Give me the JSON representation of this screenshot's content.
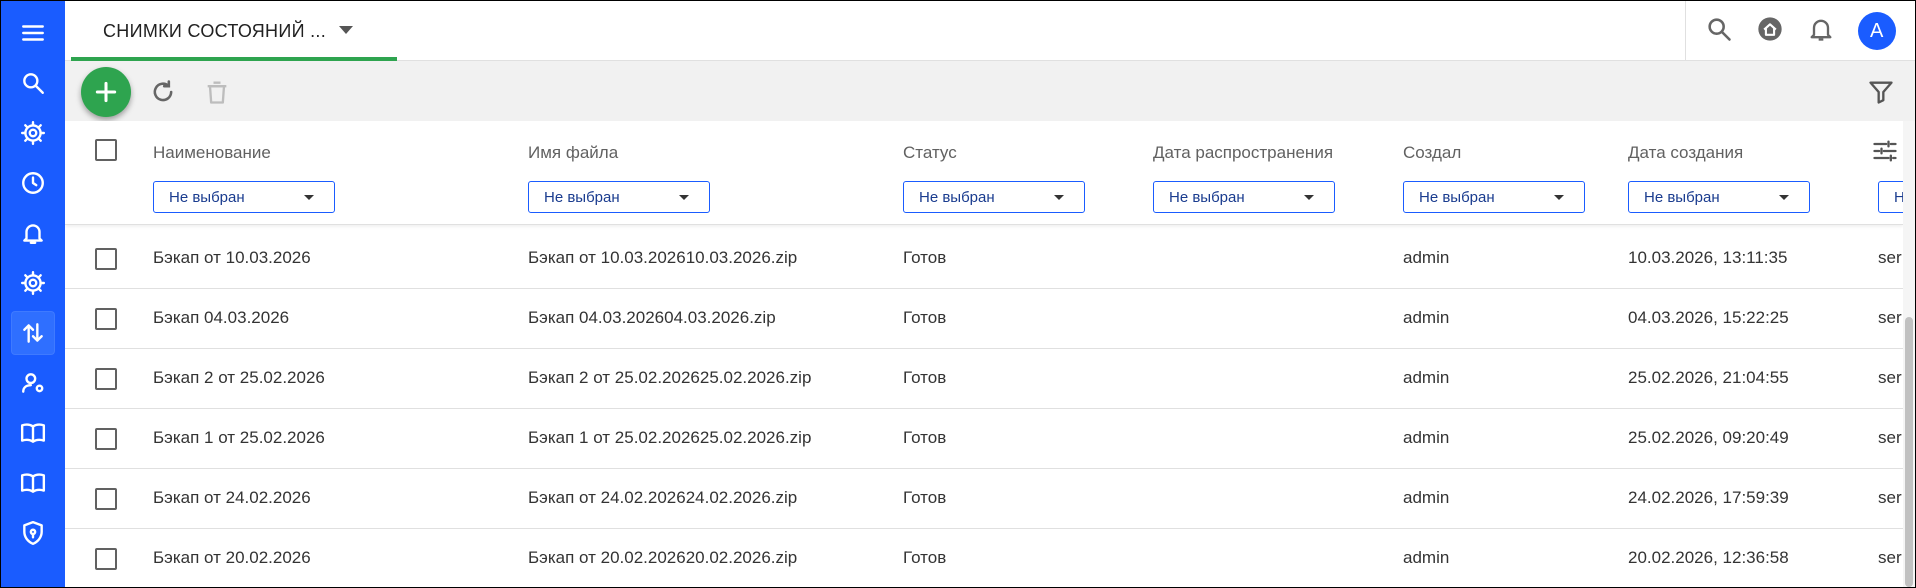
{
  "header": {
    "tab_label": "СНИМКИ СОСТОЯНИЙ ...",
    "avatar_letter": "A"
  },
  "sidebar": {
    "items": [
      {
        "icon": "menu-icon",
        "active": false
      },
      {
        "icon": "search-icon",
        "active": false
      },
      {
        "icon": "gear-icon",
        "active": false
      },
      {
        "icon": "clock-icon",
        "active": false
      },
      {
        "icon": "bell-icon",
        "active": false
      },
      {
        "icon": "gear-icon",
        "active": false
      },
      {
        "icon": "import-export-icon",
        "active": true
      },
      {
        "icon": "user-settings-icon",
        "active": false
      },
      {
        "icon": "book-icon",
        "active": false
      },
      {
        "icon": "book-icon",
        "active": false
      },
      {
        "icon": "shield-icon",
        "active": false
      }
    ]
  },
  "table": {
    "columns": [
      {
        "label": "Наименование",
        "filter": "Не выбран"
      },
      {
        "label": "Имя файла",
        "filter": "Не выбран"
      },
      {
        "label": "Статус",
        "filter": "Не выбран"
      },
      {
        "label": "Дата распространения",
        "filter": "Не выбран"
      },
      {
        "label": "Создал",
        "filter": "Не выбран"
      },
      {
        "label": "Дата создания",
        "filter": "Не выбран"
      },
      {
        "label": "",
        "filter": "Не выбран"
      }
    ],
    "rows": [
      {
        "name": "Бэкап от 10.03.2026",
        "file": "Бэкап от 10.03.202610.03.2026.zip",
        "status": "Готов",
        "dist_date": "",
        "author": "admin",
        "created": "10.03.2026, 13:11:35",
        "extra": "ser"
      },
      {
        "name": "Бэкап 04.03.2026",
        "file": "Бэкап 04.03.202604.03.2026.zip",
        "status": "Готов",
        "dist_date": "",
        "author": "admin",
        "created": "04.03.2026, 15:22:25",
        "extra": "ser"
      },
      {
        "name": "Бэкап 2 от 25.02.2026",
        "file": "Бэкап 2 от 25.02.202625.02.2026.zip",
        "status": "Готов",
        "dist_date": "",
        "author": "admin",
        "created": "25.02.2026, 21:04:55",
        "extra": "ser"
      },
      {
        "name": "Бэкап 1 от 25.02.2026",
        "file": "Бэкап 1 от 25.02.202625.02.2026.zip",
        "status": "Готов",
        "dist_date": "",
        "author": "admin",
        "created": "25.02.2026, 09:20:49",
        "extra": "ser"
      },
      {
        "name": "Бэкап от 24.02.2026",
        "file": "Бэкап от 24.02.202624.02.2026.zip",
        "status": "Готов",
        "dist_date": "",
        "author": "admin",
        "created": "24.02.2026, 17:59:39",
        "extra": "ser"
      },
      {
        "name": "Бэкап от 20.02.2026",
        "file": "Бэкап от 20.02.202620.02.2026.zip",
        "status": "Готов",
        "dist_date": "",
        "author": "admin",
        "created": "20.02.2026, 12:36:58",
        "extra": "ser"
      }
    ]
  },
  "colors": {
    "sidebar": "#1a5cff",
    "accent_green": "#2ea44f",
    "filter_border": "#1a5cff"
  }
}
